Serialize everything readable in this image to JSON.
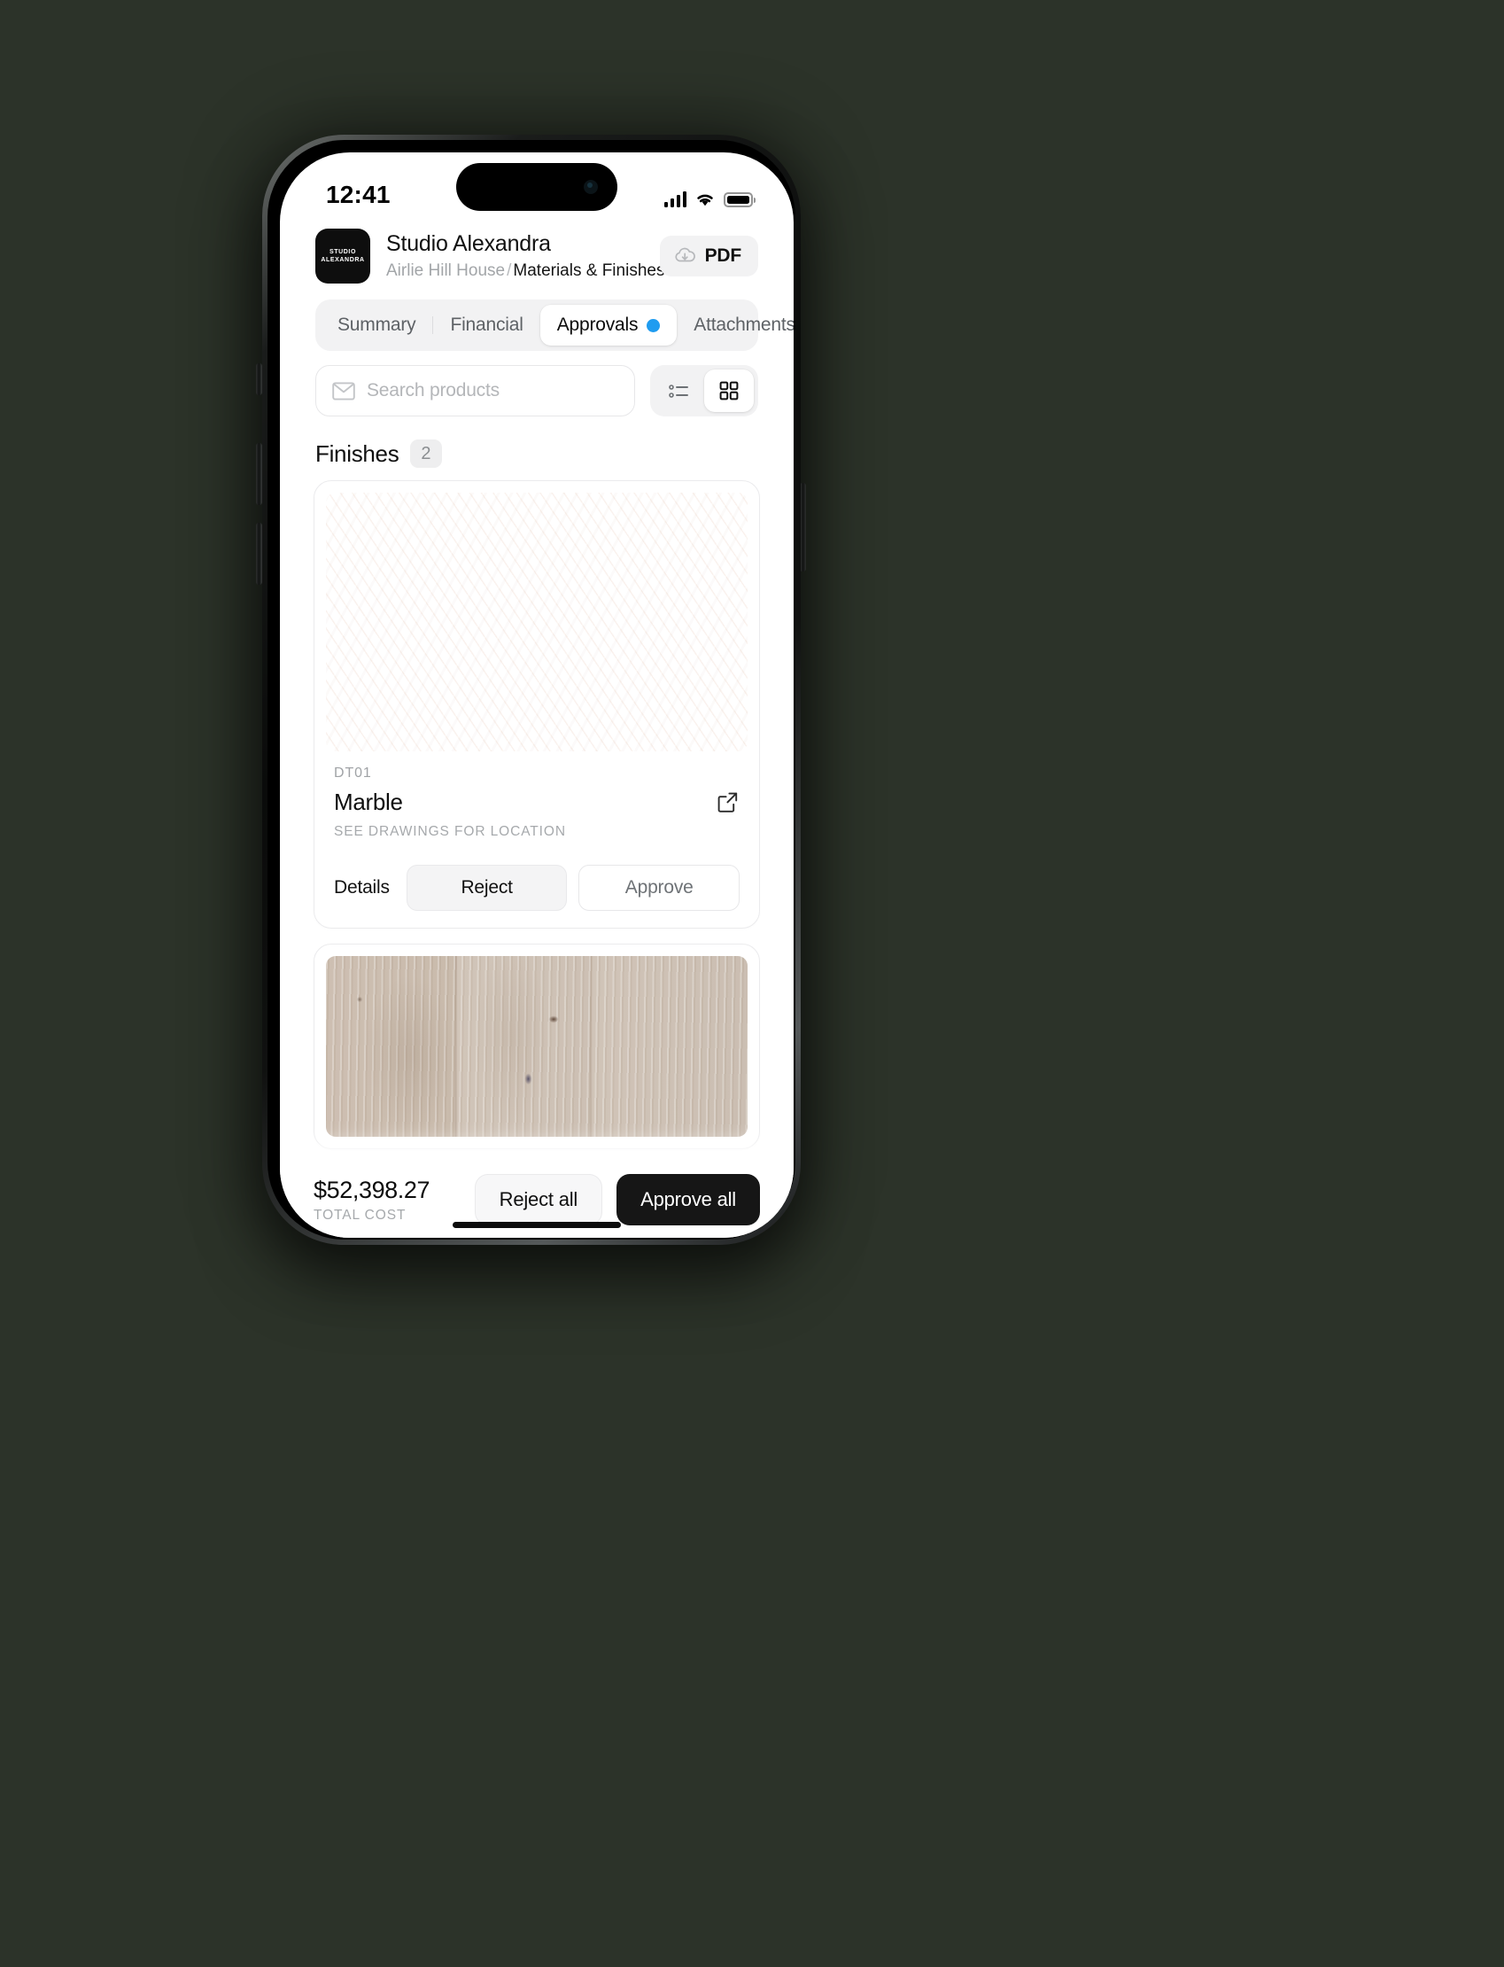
{
  "status_bar": {
    "time": "12:41",
    "icons": [
      "cellular-signal-icon",
      "wifi-icon",
      "battery-icon"
    ]
  },
  "header": {
    "logo_line1": "STUDIO",
    "logo_line2": "ALEXANDRA",
    "title": "Studio Alexandra",
    "breadcrumb_parent": "Airlie Hill House",
    "breadcrumb_separator": "/",
    "breadcrumb_current": "Materials & Finishes",
    "pdf_button": "PDF"
  },
  "tabs": {
    "items": [
      {
        "label": "Summary",
        "active": false
      },
      {
        "label": "Financial",
        "active": false
      },
      {
        "label": "Approvals",
        "active": true
      },
      {
        "label": "Attachments",
        "active": false
      }
    ],
    "active_dot_color": "#1f9cf0"
  },
  "search": {
    "placeholder": "Search products",
    "value": ""
  },
  "view_toggle": {
    "list_label": "list-view",
    "grid_label": "grid-view",
    "active": "grid"
  },
  "section": {
    "title": "Finishes",
    "count": "2"
  },
  "products": [
    {
      "code": "DT01",
      "name": "Marble",
      "location_note": "SEE DRAWINGS FOR LOCATION",
      "details_label": "Details",
      "reject_label": "Reject",
      "approve_label": "Approve",
      "swatch": "marble"
    },
    {
      "code": "",
      "name": "",
      "location_note": "",
      "details_label": "",
      "reject_label": "",
      "approve_label": "",
      "swatch": "wood"
    }
  ],
  "bottom_bar": {
    "total_amount": "$52,398.27",
    "total_label": "TOTAL COST",
    "reject_all_label": "Reject all",
    "approve_all_label": "Approve all"
  },
  "theme": {
    "background": "#2c3329",
    "accent_blue": "#1f9cf0",
    "dark_button": "#161616"
  }
}
